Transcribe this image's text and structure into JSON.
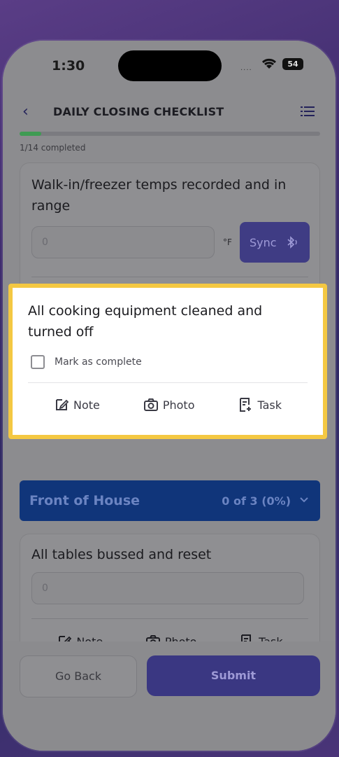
{
  "status_bar": {
    "time": "1:30",
    "signal_dots": "....",
    "battery": "54"
  },
  "header": {
    "title": "DAILY CLOSING CHECKLIST"
  },
  "progress": {
    "text": "1/14 completed",
    "fraction": 0.0714
  },
  "cards": {
    "temps": {
      "title": "Walk-in/freezer temps recorded and in range",
      "input_value": "0",
      "unit": "°F",
      "sync_label": "Sync"
    },
    "cooking": {
      "title": "All cooking equipment cleaned and turned off",
      "checkbox_label": "Mark as complete"
    },
    "tables": {
      "title": "All tables bussed and reset",
      "input_value": "0"
    }
  },
  "actions": {
    "note": "Note",
    "photo": "Photo",
    "task": "Task"
  },
  "section": {
    "title": "Front of House",
    "count": "0 of 3 (0%)"
  },
  "footer": {
    "back_label": "Go Back",
    "submit_label": "Submit"
  },
  "colors": {
    "accent": "#4f46e5",
    "section_blue": "#1d4ed8",
    "highlight": "#f4c842",
    "progress_green": "#3f9b53"
  }
}
